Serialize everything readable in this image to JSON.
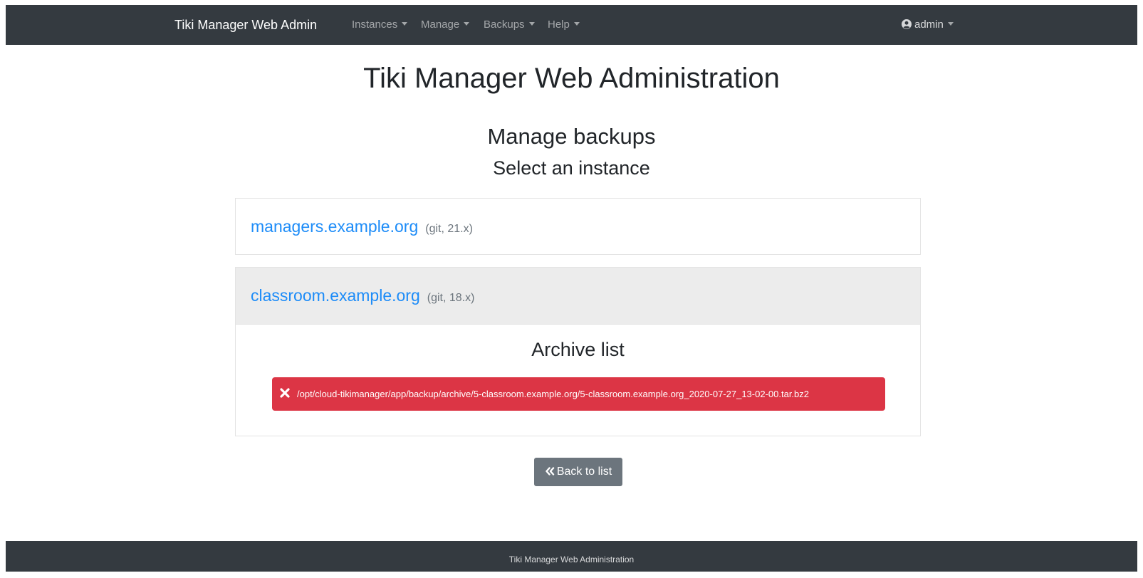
{
  "navbar": {
    "brand": "Tiki Manager Web Admin",
    "menus": [
      {
        "label": "Instances"
      },
      {
        "label": "Manage"
      },
      {
        "label": "Backups"
      },
      {
        "label": "Help"
      }
    ],
    "user": {
      "label": "admin",
      "icon": "user-circle-icon"
    }
  },
  "main": {
    "title": "Tiki Manager Web Administration",
    "section_title": "Manage backups",
    "instruction": "Select an instance"
  },
  "instances": [
    {
      "name": "managers.example.org",
      "meta": "(git, 21.x)"
    },
    {
      "name": "classroom.example.org",
      "meta": "(git, 18.x)"
    }
  ],
  "archive": {
    "title": "Archive list",
    "items": [
      {
        "path": "/opt/cloud-tikimanager/app/backup/archive/5-classroom.example.org/5-classroom.example.org_2020-07-27_13-02-00.tar.bz2",
        "icon": "close-icon"
      }
    ]
  },
  "back_button": {
    "label": "Back to list",
    "icon": "double-chevron-left-icon"
  },
  "footer": {
    "text": "Tiki Manager Web Administration"
  },
  "colors": {
    "navbar_bg": "#343a40",
    "link": "#1d8cf8",
    "danger": "#dc3545",
    "secondary": "#6c757d"
  }
}
